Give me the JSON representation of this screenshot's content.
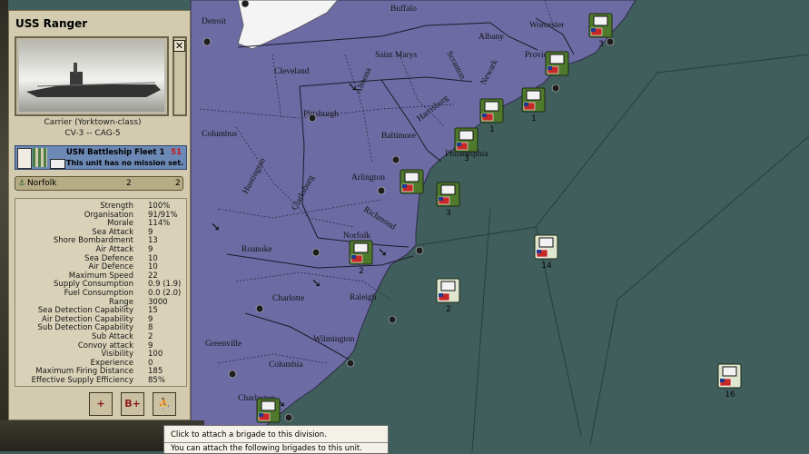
{
  "unit_panel": {
    "title": "USS Ranger",
    "class_line": "Carrier (Yorktown-class)",
    "designation": "CV-3 -- CAG-5",
    "close_icon": "close-icon",
    "fleet": {
      "name": "USN Battleship Fleet 1",
      "number": "51",
      "mission": "This unit has no mission set."
    },
    "location": {
      "name": "Norfolk",
      "value_a": "2",
      "value_b": "2"
    },
    "stats": [
      {
        "label": "Strength",
        "value": "100%"
      },
      {
        "label": "Organisation",
        "value": "91/91%"
      },
      {
        "label": "Morale",
        "value": "114%"
      },
      {
        "label": "Sea Attack",
        "value": "9"
      },
      {
        "label": "Shore Bombardment",
        "value": "13"
      },
      {
        "label": "Air Attack",
        "value": "9"
      },
      {
        "label": "Sea Defence",
        "value": "10"
      },
      {
        "label": "Air Defence",
        "value": "10"
      },
      {
        "label": "Maximum Speed",
        "value": "22"
      },
      {
        "label": "Supply Consumption",
        "value": "0.9 (1.9)"
      },
      {
        "label": "Fuel Consumption",
        "value": "0.0 (2.0)"
      },
      {
        "label": "Range",
        "value": "3000"
      },
      {
        "label": "Sea Detection Capability",
        "value": "15"
      },
      {
        "label": "Air Detection Capability",
        "value": "9"
      },
      {
        "label": "Sub Detection Capability",
        "value": "8"
      },
      {
        "label": "Sub Attack",
        "value": "2"
      },
      {
        "label": "Convoy attack",
        "value": "9"
      },
      {
        "label": "Visibility",
        "value": "100"
      },
      {
        "label": "Experience",
        "value": "0"
      },
      {
        "label": "Maximum Firing Distance",
        "value": "185"
      },
      {
        "label": "Effective Supply Efficiency",
        "value": "85%"
      }
    ],
    "buttons": [
      {
        "name": "attach-brigade-button",
        "label": "+"
      },
      {
        "name": "brigade-add-button",
        "label": "B+"
      },
      {
        "name": "detach-units-button",
        "label": "⛹"
      }
    ]
  },
  "tooltip": {
    "line1": "Click to attach a brigade to this division.",
    "line2": "You can attach the following brigades to this unit."
  },
  "map": {
    "cities": [
      {
        "name": "Detroit"
      },
      {
        "name": "Buffalo"
      },
      {
        "name": "Worcester"
      },
      {
        "name": "Albany"
      },
      {
        "name": "Saint Marys"
      },
      {
        "name": "Providence"
      },
      {
        "name": "Cleveland"
      },
      {
        "name": "Scranton"
      },
      {
        "name": "Pittsburgh"
      },
      {
        "name": "Altoona"
      },
      {
        "name": "Harrisburg"
      },
      {
        "name": "Newark"
      },
      {
        "name": "Columbus"
      },
      {
        "name": "Baltimore"
      },
      {
        "name": "Philadelphia"
      },
      {
        "name": "Huntington"
      },
      {
        "name": "Clarksburg"
      },
      {
        "name": "Arlington"
      },
      {
        "name": "Richmond"
      },
      {
        "name": "Roanoke"
      },
      {
        "name": "Norfolk"
      },
      {
        "name": "Charlotte"
      },
      {
        "name": "Raleigh"
      },
      {
        "name": "Greenville"
      },
      {
        "name": "Wilmington"
      },
      {
        "name": "Columbia"
      },
      {
        "name": "Charleston"
      }
    ],
    "counters": [
      {
        "name": "unit-counter-hq-boston",
        "number": "3",
        "kind": "HQ"
      },
      {
        "name": "unit-counter-hq-providence",
        "number": "",
        "kind": "HQ"
      },
      {
        "name": "unit-counter-infantry-ri",
        "number": "1",
        "kind": "infantry"
      },
      {
        "name": "unit-counter-infantry-nj",
        "number": "1",
        "kind": "infantry"
      },
      {
        "name": "unit-counter-armor-de",
        "number": "3",
        "kind": "armor"
      },
      {
        "name": "unit-counter-infantry-va",
        "number": "",
        "kind": "infantry"
      },
      {
        "name": "unit-counter-armor-va",
        "number": "3",
        "kind": "armor"
      },
      {
        "name": "unit-counter-infantry-nc",
        "number": "2",
        "kind": "infantry"
      },
      {
        "name": "unit-counter-fleet-atlantic",
        "number": "14",
        "kind": "fleet"
      },
      {
        "name": "unit-counter-fleet-norfolk",
        "number": "2",
        "kind": "fleet"
      },
      {
        "name": "unit-counter-fleet-east",
        "number": "16",
        "kind": "fleet"
      },
      {
        "name": "unit-counter-infantry-sc",
        "number": "",
        "kind": "infantry"
      }
    ]
  },
  "colors": {
    "land": "#6d6ba3",
    "sea": "#3f5e5c",
    "counter_green": "#4f7a2c",
    "panel": "#d3cbb0"
  }
}
